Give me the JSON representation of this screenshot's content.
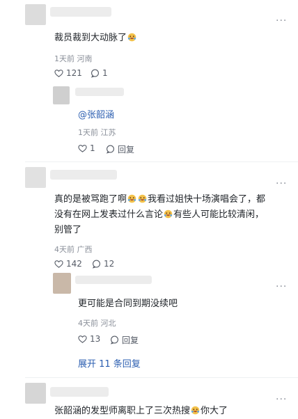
{
  "comments": [
    {
      "text": "裁员裁到大动脉了",
      "meta": "1天前 河南",
      "likes": "121",
      "replies": "1",
      "reply": {
        "mention": "@张韶涵",
        "meta": "1天前 江苏",
        "likes": "1",
        "reply_label": "回复"
      }
    },
    {
      "line1": "真的是被骂跑了啊",
      "line1b": "我看过姐快十场演唱会了，都",
      "line2": "没有在网上发表过什么言论",
      "line2b": "有些人可能比较清闲，",
      "line3": "别管了",
      "meta": "4天前 广西",
      "likes": "142",
      "replies": "12",
      "reply": {
        "text": "更可能是合同到期没续吧",
        "meta": "4天前 河北",
        "likes": "13",
        "reply_label": "回复"
      },
      "expand": "展开 11 条回复"
    },
    {
      "text": "张韶涵的发型师离职上了三次热搜",
      "text_b": "你大了"
    }
  ],
  "more": "···",
  "emoji_name": "laughing-crying-emoji",
  "colors": {
    "link": "#2a5db0",
    "meta": "#8a8f99"
  }
}
